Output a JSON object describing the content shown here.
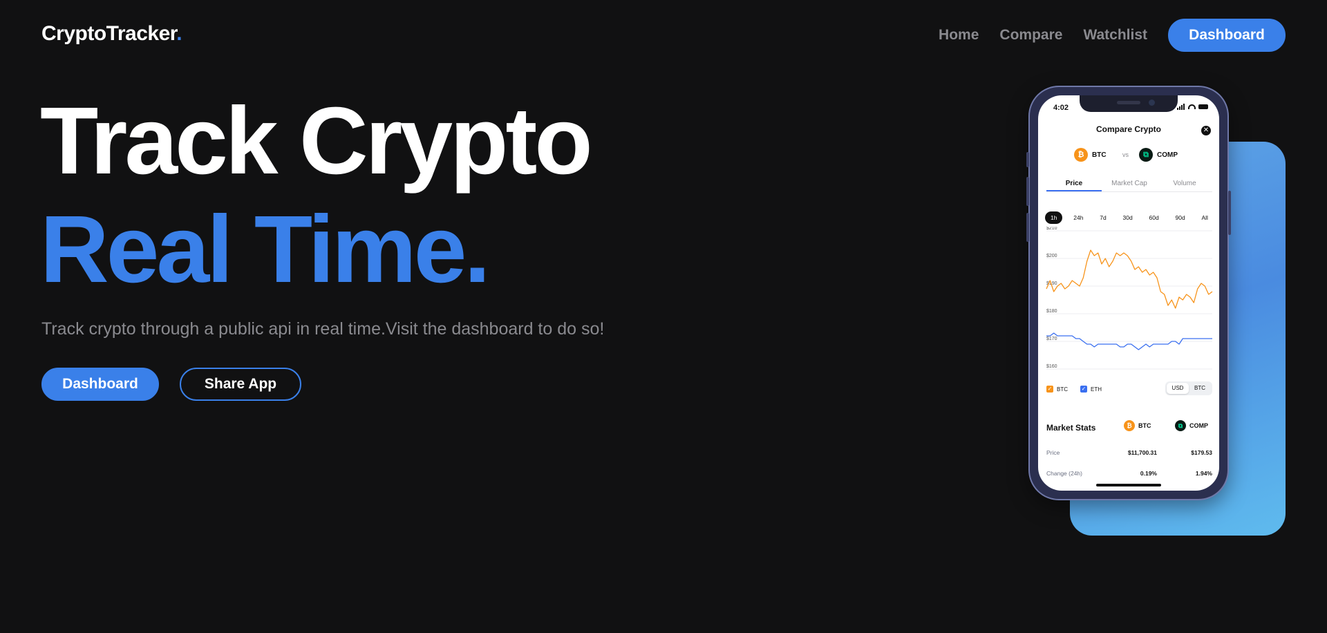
{
  "nav": {
    "logo_text": "CryptoTracker",
    "logo_dot": ".",
    "links": [
      "Home",
      "Compare",
      "Watchlist"
    ],
    "cta_label": "Dashboard"
  },
  "hero": {
    "line1": "Track Crypto",
    "line2": "Real Time.",
    "subtitle": "Track crypto through a public api in real time.Visit the dashboard to do so!",
    "primary_button": "Dashboard",
    "secondary_button": "Share App"
  },
  "phone": {
    "time": "4:02",
    "title": "Compare Crypto",
    "coin_a": "BTC",
    "coin_b": "COMP",
    "vs": "vs",
    "tabs": [
      "Price",
      "Market Cap",
      "Volume"
    ],
    "active_tab": "Price",
    "ranges": [
      "1h",
      "24h",
      "7d",
      "30d",
      "60d",
      "90d",
      "All"
    ],
    "active_range": "1h",
    "legend": [
      "BTC",
      "ETH"
    ],
    "currency_options": [
      "USD",
      "BTC"
    ],
    "active_currency": "USD",
    "market_stats": {
      "title": "Market Stats",
      "coin_a": "BTC",
      "coin_b": "COMP",
      "rows": [
        {
          "label": "Price",
          "a": "$11,700.31",
          "b": "$179.53"
        },
        {
          "label": "Change (24h)",
          "a": "0.19%",
          "b": "1.94%"
        }
      ]
    }
  },
  "colors": {
    "accent": "#3a80e9",
    "background": "#111112",
    "muted_text": "#8a8a8f",
    "btc_line": "#f7931a",
    "eth_line": "#3a6ff0"
  },
  "chart_data": {
    "type": "line",
    "yticks": [
      "$210",
      "$200",
      "$190",
      "$180",
      "$170",
      "$160"
    ],
    "ylim": [
      160,
      210
    ],
    "grid": true,
    "series": [
      {
        "name": "BTC",
        "color": "#f7931a",
        "values": [
          189,
          192,
          188,
          190,
          191,
          189,
          190,
          192,
          191,
          190,
          193,
          199,
          203,
          201,
          202,
          198,
          200,
          197,
          199,
          202,
          201,
          202,
          201,
          199,
          196,
          197,
          195,
          196,
          194,
          195,
          193,
          188,
          187,
          183,
          185,
          182,
          186,
          185,
          187,
          186,
          184,
          189,
          191,
          190,
          187,
          188
        ]
      },
      {
        "name": "ETH",
        "color": "#3a6ff0",
        "values": [
          172,
          172,
          173,
          172,
          172,
          172,
          172,
          172,
          171,
          171,
          170,
          169,
          169,
          168,
          169,
          169,
          169,
          169,
          169,
          169,
          168,
          168,
          169,
          169,
          168,
          167,
          168,
          169,
          168,
          169,
          169,
          169,
          169,
          169,
          170,
          170,
          169,
          171,
          171,
          171,
          171,
          171,
          171,
          171,
          171,
          171
        ]
      }
    ]
  }
}
